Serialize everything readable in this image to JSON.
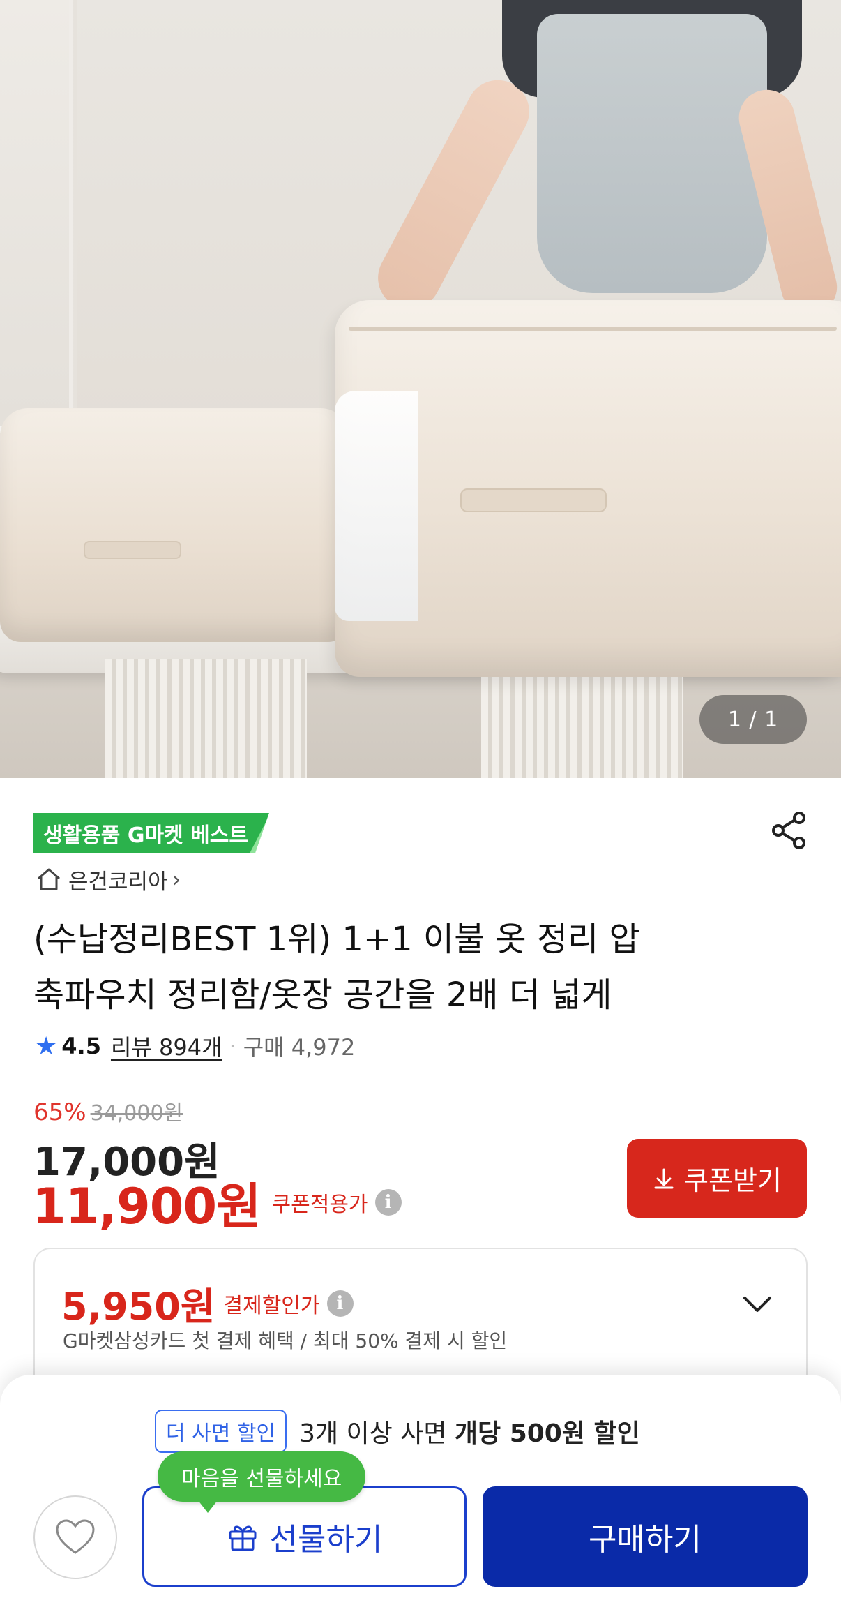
{
  "gallery": {
    "counter": "1 / 1"
  },
  "badge": {
    "text": "생활용품 G마켓 베스트",
    "color": "#2bb24c"
  },
  "seller": {
    "name": "은건코리아",
    "chevron": "›"
  },
  "product": {
    "title_line1": "(수납정리BEST 1위) 1+1 이불 옷 정리 압",
    "title_line2": "축파우치 정리함/옷장 공간을 2배 더 넓게"
  },
  "rating": {
    "star_icon": "★",
    "score": "4.5",
    "reviews": "리뷰 894개",
    "separator": "·",
    "purchases": "구매 4,972"
  },
  "pricing": {
    "discount_rate": "65%",
    "original_price": "34,000원",
    "price": "17,000원",
    "coupon_price": "11,900원",
    "coupon_label": "쿠폰적용가",
    "coupon_button": "쿠폰받기",
    "accent_color": "#d8261b"
  },
  "card_discount": {
    "price": "5,950원",
    "label": "결제할인가",
    "description": "G마켓삼성카드 첫 결제 혜택 / 최대 50% 결제 시 할인"
  },
  "bulk": {
    "tag": "더 사면 할인",
    "text_plain": "3개 이상 사면 ",
    "text_bold": "개당 500원 할인"
  },
  "actions": {
    "gift_tooltip": "마음을 선물하세요",
    "gift_button": "선물하기",
    "buy_button": "구매하기",
    "brand_color": "#0a2aa8"
  },
  "info_icon_glyph": "i"
}
